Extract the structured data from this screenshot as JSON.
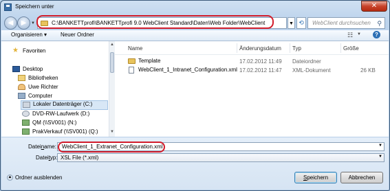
{
  "window": {
    "title": "Speichern unter",
    "close_glyph": "✕"
  },
  "address": {
    "path": "C:\\BANKETTprofi\\BANKETTprofi 9.0 WebClient Standard\\Daten\\Web Folder\\WebClient",
    "search_placeholder": "WebClient durchsuchen"
  },
  "toolbar": {
    "organize": "Organisieren ▾",
    "new_folder": "Neuer Ordner"
  },
  "nav": {
    "items": [
      {
        "label": "Favoriten",
        "icon": "star-icon"
      },
      {
        "label": "Desktop",
        "icon": "desktop-icon"
      },
      {
        "label": "Bibliotheken",
        "icon": "library-icon"
      },
      {
        "label": "Uwe Richter",
        "icon": "user-folder-icon"
      },
      {
        "label": "Computer",
        "icon": "computer-icon"
      },
      {
        "label": "Lokaler Datenträger (C:)",
        "icon": "drive-icon"
      },
      {
        "label": "DVD-RW-Laufwerk (D:)",
        "icon": "dvd-icon"
      },
      {
        "label": "QM (\\\\SV001) (N:)",
        "icon": "network-drive-icon"
      },
      {
        "label": "PrakVerkauf (\\\\SV001) (Q:)",
        "icon": "network-drive-icon"
      }
    ]
  },
  "columns": {
    "name": "Name",
    "date": "Änderungsdatum",
    "type": "Typ",
    "size": "Größe"
  },
  "files": [
    {
      "name": "Template",
      "date": "17.02.2012 11:49",
      "type": "Dateiordner",
      "size": "",
      "kind": "folder"
    },
    {
      "name": "WebClient_1_Intranet_Configuration.xml",
      "date": "17.02.2012 11:47",
      "type": "XML-Dokument",
      "size": "26 KB",
      "kind": "xml"
    }
  ],
  "form": {
    "filename_label_pre": "Datei",
    "filename_label_u": "n",
    "filename_label_post": "ame:",
    "filename_value": "WebClient_1_Extranet_Configuration.xml",
    "filetype_label_pre": "Datei",
    "filetype_label_u": "t",
    "filetype_label_post": "yp:",
    "filetype_value": "XSL File (*.xml)"
  },
  "footer": {
    "hide_folders": "Ordner ausblenden",
    "save_u": "S",
    "save_rest": "peichern",
    "cancel": "Abbrechen"
  }
}
